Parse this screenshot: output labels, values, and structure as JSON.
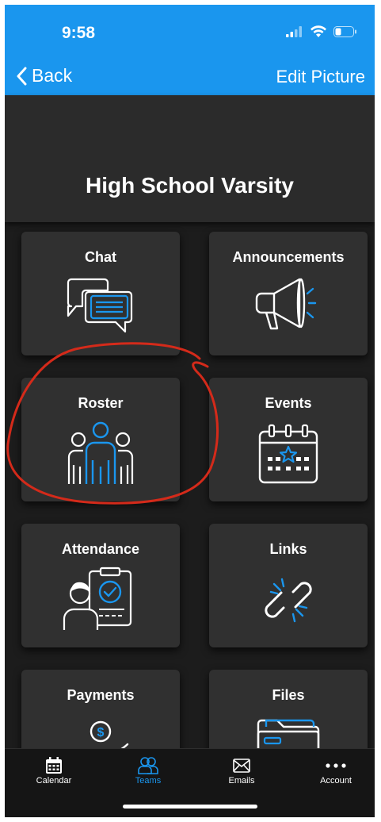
{
  "status": {
    "time": "9:58"
  },
  "nav": {
    "back_label": "Back",
    "edit_label": "Edit Picture"
  },
  "header": {
    "team_name": "High School Varsity"
  },
  "tiles": [
    {
      "label": "Chat",
      "icon": "chat-icon"
    },
    {
      "label": "Announcements",
      "icon": "megaphone-icon"
    },
    {
      "label": "Roster",
      "icon": "roster-icon"
    },
    {
      "label": "Events",
      "icon": "calendar-star-icon"
    },
    {
      "label": "Attendance",
      "icon": "attendance-clipboard-icon"
    },
    {
      "label": "Links",
      "icon": "link-icon"
    },
    {
      "label": "Payments",
      "icon": "payment-icon"
    },
    {
      "label": "Files",
      "icon": "folder-icon"
    }
  ],
  "tabbar": {
    "items": [
      {
        "label": "Calendar",
        "icon": "calendar-icon"
      },
      {
        "label": "Teams",
        "icon": "teams-icon",
        "active": true
      },
      {
        "label": "Emails",
        "icon": "mail-icon"
      },
      {
        "label": "Account",
        "icon": "more-icon"
      }
    ]
  },
  "colors": {
    "accent": "#1a96ee",
    "background": "#1c1c1c",
    "tile": "#303030",
    "annotation": "#d42a1a"
  }
}
